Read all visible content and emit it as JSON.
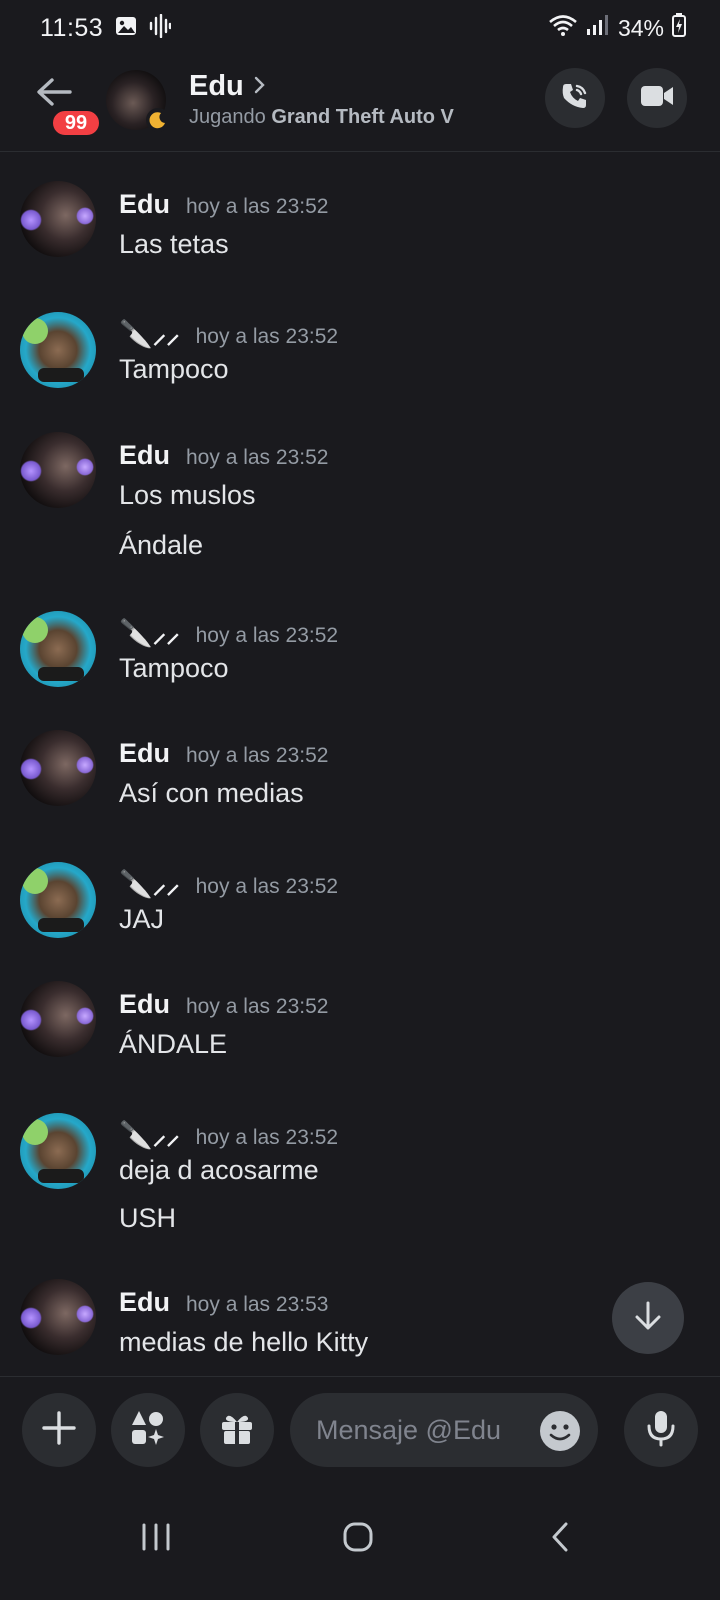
{
  "status_bar": {
    "time": "11:53",
    "battery": "34%",
    "icons": [
      "image-icon",
      "voice-waveform-icon",
      "wifi-icon",
      "signal-icon",
      "battery-charging-icon"
    ]
  },
  "header": {
    "unread_badge": "99",
    "name": "Edu",
    "activity_prefix": "Jugando",
    "activity_game": "Grand Theft Auto V",
    "status": "idle"
  },
  "messages": [
    {
      "author": "Edu",
      "time": "hoy a las 23:52",
      "lines": [
        "Las tetas"
      ]
    },
    {
      "author": "🔪⸝⸝",
      "time": "hoy a las 23:52",
      "lines": [
        "Tampoco"
      ]
    },
    {
      "author": "Edu",
      "time": "hoy a las 23:52",
      "lines": [
        "Los muslos",
        "Ándale"
      ]
    },
    {
      "author": "🔪⸝⸝",
      "time": "hoy a las 23:52",
      "lines": [
        "Tampoco"
      ]
    },
    {
      "author": "Edu",
      "time": "hoy a las 23:52",
      "lines": [
        "Así con medias"
      ]
    },
    {
      "author": "🔪⸝⸝",
      "time": "hoy a las 23:52",
      "lines": [
        "JAJ"
      ]
    },
    {
      "author": "Edu",
      "time": "hoy a las 23:52",
      "lines": [
        "ÁNDALE"
      ]
    },
    {
      "author": "🔪⸝⸝",
      "time": "hoy a las 23:52",
      "lines": [
        "deja d acosarme",
        "USH"
      ]
    },
    {
      "author": "Edu",
      "time": "hoy a las 23:53",
      "lines": [
        "medias de hello Kitty"
      ]
    }
  ],
  "composer": {
    "placeholder": "Mensaje @Edu"
  },
  "colors": {
    "background": "#1a1a1e",
    "badge": "#f23f43",
    "idle": "#f0b232"
  }
}
